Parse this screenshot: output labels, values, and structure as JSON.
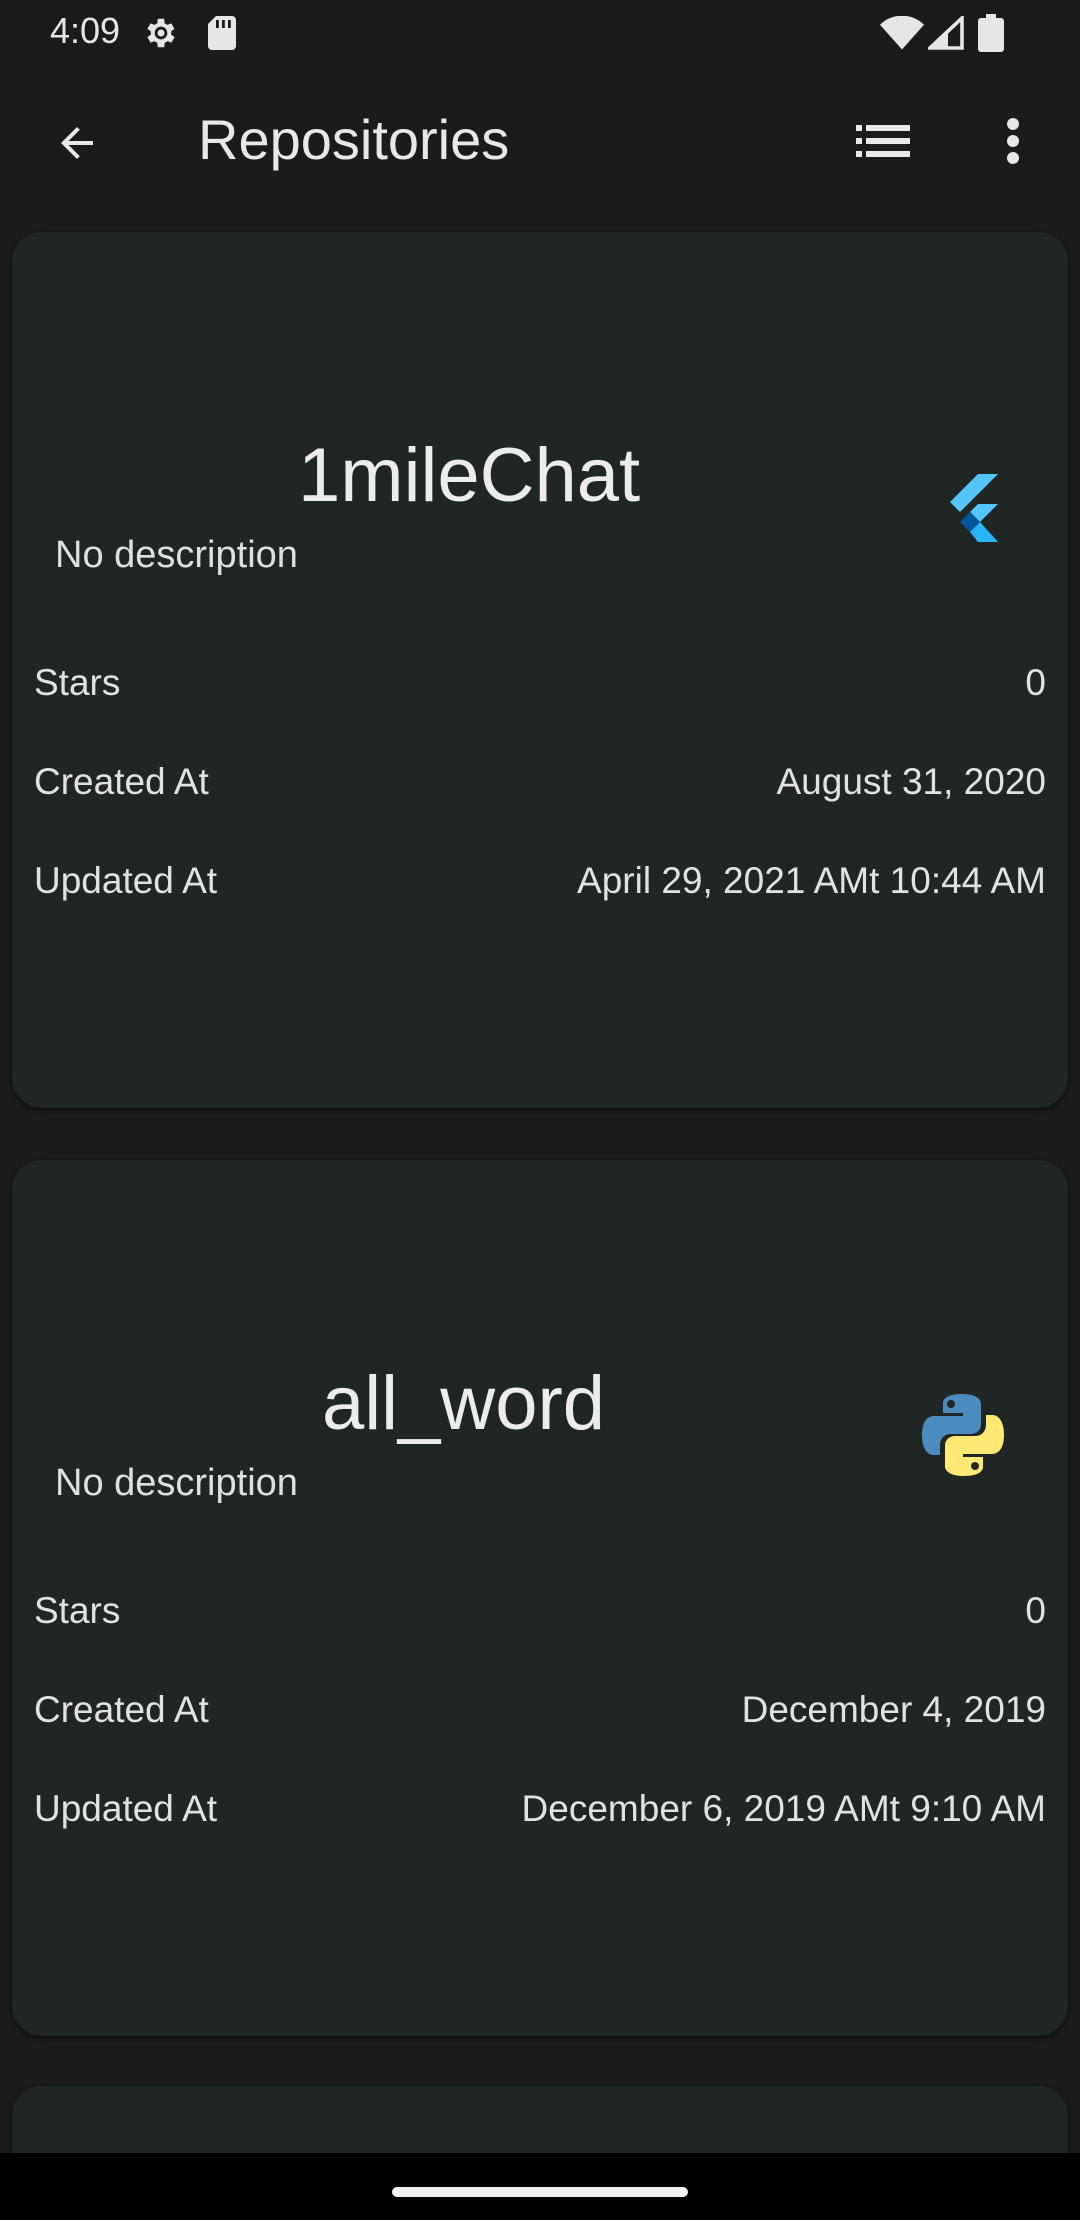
{
  "status_bar": {
    "time": "4:09",
    "icons": [
      "settings-gear-icon",
      "sd-card-icon",
      "wifi-icon",
      "cell-signal-icon",
      "battery-icon"
    ]
  },
  "app_bar": {
    "title": "Repositories",
    "back_icon": "back-arrow-icon",
    "list_icon": "list-view-icon",
    "more_icon": "more-vert-icon"
  },
  "repositories": [
    {
      "name": "1mileChat",
      "description": "No description",
      "language_icon": "flutter-icon",
      "stars_label": "Stars",
      "stars": "0",
      "created_label": "Created At",
      "created": "August 31, 2020",
      "updated_label": "Updated At",
      "updated": "April 29, 2021 AMt 10:44 AM"
    },
    {
      "name": "all_word",
      "description": "No description",
      "language_icon": "python-icon",
      "stars_label": "Stars",
      "stars": "0",
      "created_label": "Created At",
      "created": "December 4, 2019",
      "updated_label": "Updated At",
      "updated": "December 6, 2019 AMt 9:10 AM"
    }
  ],
  "colors": {
    "background": "#1b1b1b",
    "card": "#202624",
    "flutter_light": "#54c5f8",
    "flutter_dark": "#01579b",
    "python_blue": "#4b8bbe",
    "python_yellow": "#ffe873"
  }
}
